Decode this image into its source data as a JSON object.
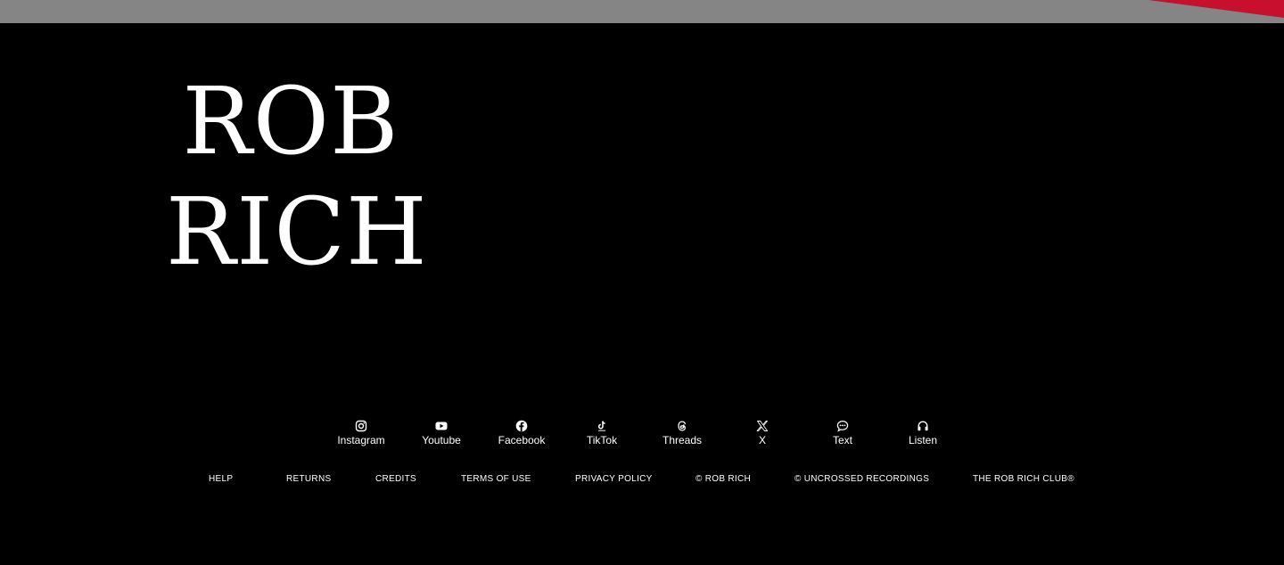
{
  "brand": {
    "line1": "ROB",
    "line2": "RICH"
  },
  "colors": {
    "background": "#000000",
    "top_strip": "#858585",
    "accent_red": "#c8102e",
    "text": "#ffffff"
  },
  "socials": [
    {
      "label": "Instagram",
      "icon": "instagram-icon"
    },
    {
      "label": "Youtube",
      "icon": "youtube-icon"
    },
    {
      "label": "Facebook",
      "icon": "facebook-icon"
    },
    {
      "label": "TikTok",
      "icon": "tiktok-icon"
    },
    {
      "label": "Threads",
      "icon": "threads-icon"
    },
    {
      "label": "X",
      "icon": "x-icon"
    },
    {
      "label": "Text",
      "icon": "chat-bubble-icon"
    },
    {
      "label": "Listen",
      "icon": "headphones-icon"
    }
  ],
  "footer_links": [
    {
      "label": "HELP"
    },
    {
      "label": "RETURNS"
    },
    {
      "label": "CREDITS"
    },
    {
      "label": "TERMS OF USE"
    },
    {
      "label": "PRIVACY POLICY"
    },
    {
      "label": "© ROB RICH"
    },
    {
      "label": "© UNCROSSED RECORDINGS"
    },
    {
      "label": "THE ROB RICH CLUB®"
    }
  ]
}
